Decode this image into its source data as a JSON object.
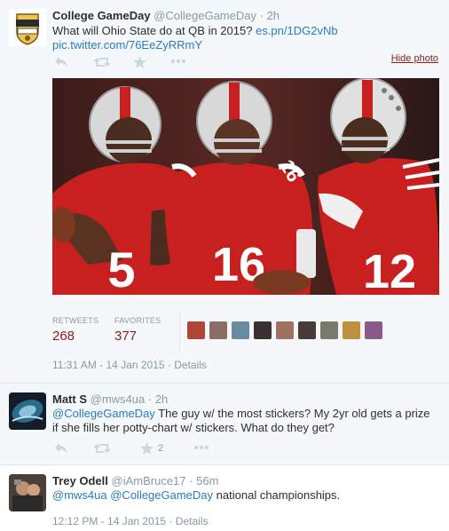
{
  "tweets": [
    {
      "name": "College GameDay",
      "handle": "@CollegeGameDay",
      "sep": "·",
      "time": "2h",
      "text": "What will Ohio State do at QB in 2015?",
      "link1": "es.pn/1DG2vNb",
      "link2": "pic.twitter.com/76EeZyRRmY",
      "hide_photo": "Hide photo",
      "stats": {
        "retweets_label": "RETWEETS",
        "retweets_value": "268",
        "favorites_label": "FAVORITES",
        "favorites_value": "377"
      },
      "timestamp": "11:31 AM - 14 Jan 2015",
      "details": "Details",
      "photo_jerseys": [
        "5",
        "16",
        "16",
        "12"
      ],
      "avatar_text": "COLLEGE GAMEDAY"
    },
    {
      "name": "Matt S",
      "handle": "@mws4ua",
      "sep": "·",
      "time": "2h",
      "mention": "@CollegeGameDay",
      "text": "The guy w/ the most stickers? My 2yr old gets a prize if she fills her potty-chart w/ stickers. What do they get?",
      "favorite_count": "2"
    },
    {
      "name": "Trey Odell",
      "handle": "@iAmBruce17",
      "sep": "·",
      "time": "56m",
      "mention1": "@mws4ua",
      "mention2": "@CollegeGameDay",
      "text": "national championships.",
      "timestamp": "12:12 PM - 14 Jan 2015",
      "details": "Details"
    }
  ],
  "icons": {
    "reply": "reply-icon",
    "retweet": "retweet-icon",
    "favorite": "star-icon",
    "more": "more-icon"
  },
  "colors": {
    "link": "#2b7bb9",
    "stat": "#8b1a1a",
    "muted": "#8899a6",
    "icon": "#ccd6dd",
    "jersey_red": "#c8201e"
  }
}
